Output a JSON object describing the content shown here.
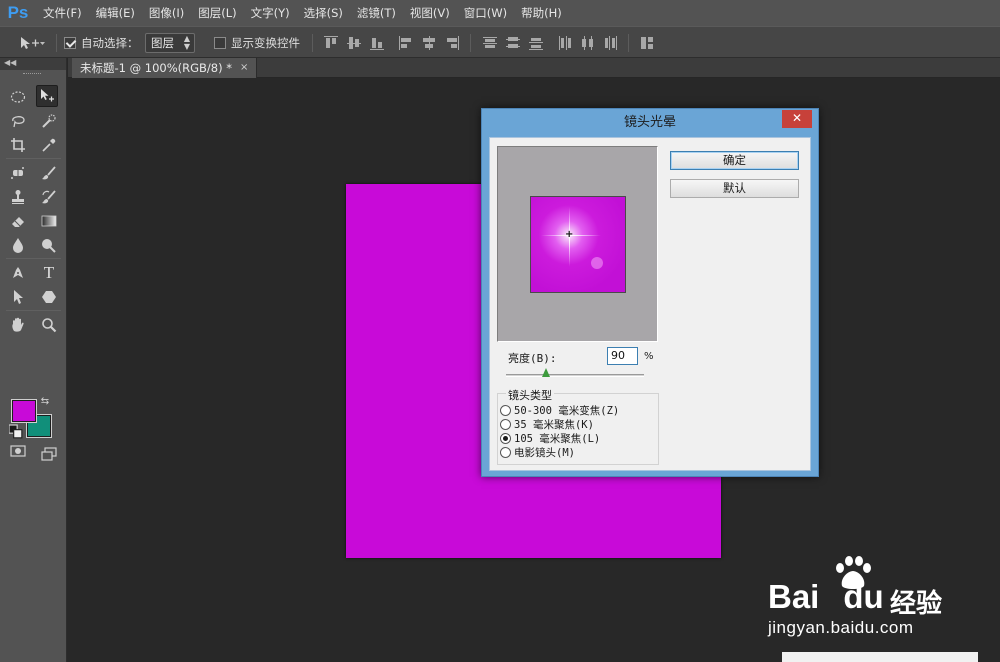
{
  "app": {
    "logo": "Ps"
  },
  "menu": [
    "文件(F)",
    "编辑(E)",
    "图像(I)",
    "图层(L)",
    "文字(Y)",
    "选择(S)",
    "滤镜(T)",
    "视图(V)",
    "窗口(W)",
    "帮助(H)"
  ],
  "options": {
    "auto_select_label": "自动选择：",
    "auto_select_checked": true,
    "layer_select_value": "图层",
    "show_transform_label": "显示变换控件",
    "show_transform_checked": false
  },
  "tab": {
    "title": "未标题-1 @ 100%(RGB/8) *",
    "close": "×"
  },
  "colors": {
    "foreground": "#c80ad8",
    "background": "#118f7a",
    "canvas": "#c80ad8"
  },
  "dialog": {
    "title": "镜头光晕",
    "close": "✕",
    "ok_button": "确定",
    "default_button": "默认",
    "brightness_label": "亮度(B):",
    "brightness_value": "90",
    "percent": "%",
    "brightness_percent": 90,
    "lens_group_label": "镜头类型",
    "lens_types": [
      {
        "label": "50-300 毫米变焦(Z)",
        "selected": false
      },
      {
        "label": "35 毫米聚焦(K)",
        "selected": false
      },
      {
        "label": "105 毫米聚焦(L)",
        "selected": true
      },
      {
        "label": "电影镜头(M)",
        "selected": false
      }
    ]
  },
  "watermark": {
    "logo": "Bai",
    "logo_tail": "du",
    "cn": "经验",
    "url": "jingyan.baidu.com"
  }
}
